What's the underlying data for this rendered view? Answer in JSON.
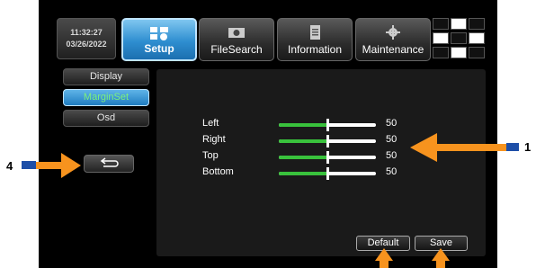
{
  "clock": {
    "time": "11:32:27",
    "date": "03/26/2022"
  },
  "tabs": [
    {
      "label": "Setup",
      "icon": "setup-icon",
      "active": true
    },
    {
      "label": "FileSearch",
      "icon": "camera-icon"
    },
    {
      "label": "Information",
      "icon": "document-icon"
    },
    {
      "label": "Maintenance",
      "icon": "wrench-gear-icon"
    }
  ],
  "sidebar": {
    "items": [
      {
        "label": "Display"
      },
      {
        "label": "MarginSet",
        "active": true
      },
      {
        "label": "Osd"
      }
    ]
  },
  "margins": [
    {
      "label": "Left",
      "value": "50",
      "fraction": 0.5
    },
    {
      "label": "Right",
      "value": "50",
      "fraction": 0.5
    },
    {
      "label": "Top",
      "value": "50",
      "fraction": 0.5
    },
    {
      "label": "Bottom",
      "value": "50",
      "fraction": 0.5
    }
  ],
  "actions": {
    "default_label": "Default",
    "save_label": "Save"
  },
  "callouts": {
    "one": "1",
    "four": "4"
  },
  "colors": {
    "accent": "#2e8ed0",
    "slider_fill": "#39c23c",
    "active_text": "#7df07d",
    "arrow": "#f7931e",
    "marker": "#1e4fa8"
  }
}
